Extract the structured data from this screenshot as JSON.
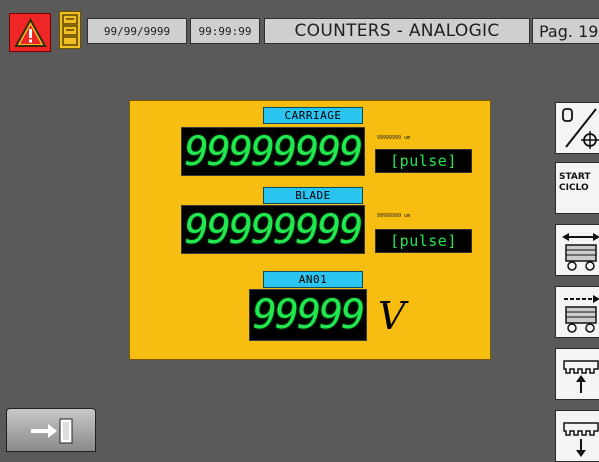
{
  "header": {
    "date": "99/99/9999",
    "time": "99:99:99",
    "title": "COUNTERS - ANALOGIC",
    "page": "Pag. 19"
  },
  "counters": [
    {
      "label": "CARRIAGE",
      "value": "99999999",
      "small_value": "99999999 um",
      "unit": "[pulse]"
    },
    {
      "label": "BLADE",
      "value": "99999999",
      "small_value": "99999999 um",
      "unit": "[pulse]"
    }
  ],
  "analog": {
    "label": "AN01",
    "value": "99999",
    "unit": "V"
  },
  "side_buttons": {
    "start_cycle_label": "START\nCICLO"
  },
  "colors": {
    "panel": "#f7bd10",
    "tag": "#2ac4f0",
    "digits": "#22e850",
    "alarm": "#ee2626"
  },
  "icons": {
    "alarm": "warning-triangle-icon",
    "user": "user-level-icon",
    "toggle": "hand-sensor-toggle-icon",
    "carriage_both": "carriage-bidirectional-icon",
    "carriage_right": "carriage-right-icon",
    "blade_up": "blade-up-icon",
    "blade_down": "blade-down-icon",
    "exit": "exit-door-icon"
  }
}
